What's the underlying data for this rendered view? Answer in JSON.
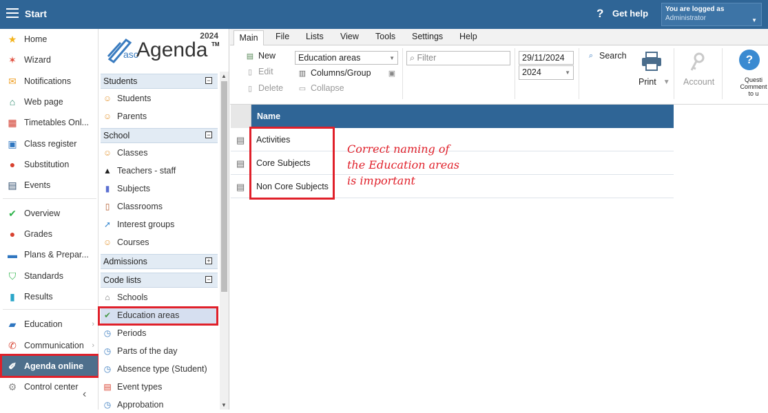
{
  "topbar": {
    "start_label": "Start",
    "help_label": "Get help",
    "logged_in_label": "You are logged as",
    "user": "Administrator"
  },
  "leftnav": {
    "items": [
      {
        "label": "Home",
        "icon": "star-icon"
      },
      {
        "label": "Wizard",
        "icon": "wand-icon"
      },
      {
        "label": "Notifications",
        "icon": "envelope-icon"
      },
      {
        "label": "Web page",
        "icon": "house-icon"
      },
      {
        "label": "Timetables Onl...",
        "icon": "timetable-icon"
      },
      {
        "label": "Class register",
        "icon": "register-icon"
      },
      {
        "label": "Substitution",
        "icon": "substitution-icon"
      },
      {
        "label": "Events",
        "icon": "calendar-icon"
      },
      {
        "label": "Overview",
        "icon": "check-circle-icon"
      },
      {
        "label": "Grades",
        "icon": "grades-icon"
      },
      {
        "label": "Plans & Prepar...",
        "icon": "briefcase-icon"
      },
      {
        "label": "Standards",
        "icon": "shield-icon"
      },
      {
        "label": "Results",
        "icon": "bar-chart-icon"
      },
      {
        "label": "Education",
        "icon": "book-icon"
      },
      {
        "label": "Communication",
        "icon": "chat-icon"
      },
      {
        "label": "Agenda online",
        "icon": "agenda-icon"
      },
      {
        "label": "Control center",
        "icon": "gear-icon"
      }
    ]
  },
  "midpanel": {
    "logo_year": "2024",
    "logo_asc": "asc",
    "logo_name": "Agenda",
    "logo_tm": "TM",
    "sections": {
      "students": {
        "title": "Students",
        "toggle": "−",
        "items": [
          "Students",
          "Parents"
        ]
      },
      "school": {
        "title": "School",
        "toggle": "−",
        "items": [
          "Classes",
          "Teachers - staff",
          "Subjects",
          "Classrooms",
          "Interest groups",
          "Courses"
        ]
      },
      "admissions": {
        "title": "Admissions",
        "toggle": "+"
      },
      "code_lists": {
        "title": "Code lists",
        "toggle": "−",
        "items": [
          "Schools",
          "Education areas",
          "Periods",
          "Parts of the day",
          "Absence type (Student)",
          "Event types",
          "Approbation"
        ]
      }
    }
  },
  "menubar": {
    "items": [
      "Main",
      "File",
      "Lists",
      "View",
      "Tools",
      "Settings",
      "Help"
    ]
  },
  "ribbon": {
    "new_label": "New",
    "edit_label": "Edit",
    "delete_label": "Delete",
    "list_select": "Education areas",
    "columns_label": "Columns/Group",
    "collapse_label": "Collapse",
    "filter_placeholder": "Filter",
    "date_value": "29/11/2024",
    "year_value": "2024",
    "search_label": "Search",
    "print_label": "Print",
    "account_label": "Account",
    "question_label_1": "Questi",
    "question_label_2": "Comment",
    "question_label_3": "to u"
  },
  "grid": {
    "header": "Name",
    "rows": [
      "Activities",
      "Core Subjects",
      "Non Core Subjects"
    ]
  },
  "annotation": {
    "line1": "Correct naming of",
    "line2": "the Education areas",
    "line3": "is important"
  },
  "colors": {
    "topbar": "#2f6596",
    "highlight_red": "#e0202a",
    "nav_active": "#4e6f8c"
  }
}
